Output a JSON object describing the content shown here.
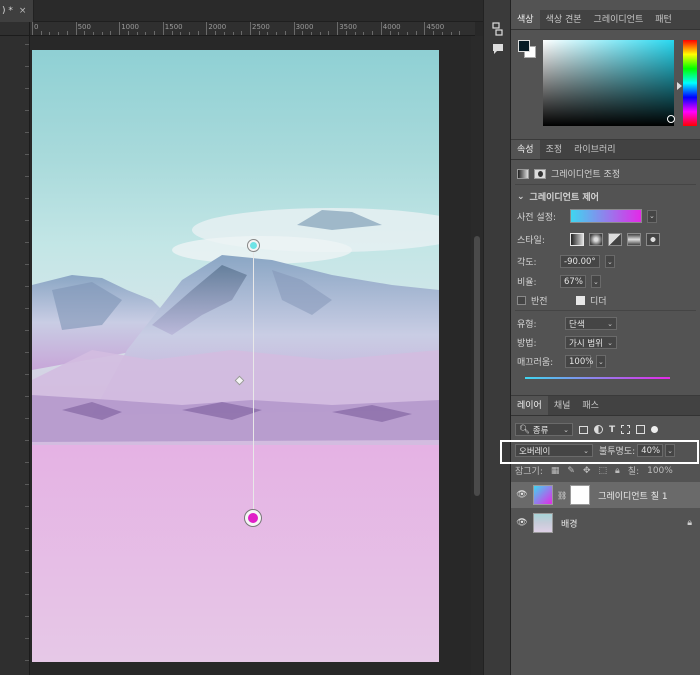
{
  "document": {
    "tab_title": ") *",
    "tab_close": "×",
    "ruler_labels": [
      "0",
      "500",
      "1000",
      "1500",
      "2000",
      "2500",
      "3000",
      "3500",
      "4000",
      "4500"
    ]
  },
  "tool_strip": {
    "icons": [
      "history-icon",
      "comment-icon"
    ]
  },
  "color_panel": {
    "tabs": [
      "색상",
      "색상 견본",
      "그레이디언트",
      "패턴"
    ],
    "foreground_color": "#061a24",
    "background_color": "#ffffff",
    "picker_hue": "#28d8f0"
  },
  "properties_panel": {
    "tabs": [
      "속성",
      "조정",
      "라이브러리"
    ],
    "adjustment_title": "그레이디언트 조정",
    "section_title": "그레이디언트 제어",
    "preset_label": "사전 설정:",
    "style_label": "스타일:",
    "angle_label": "각도:",
    "angle_value": "-90.00°",
    "scale_label": "비율:",
    "scale_value": "67%",
    "reverse_label": "반전",
    "reverse_checked": false,
    "dither_label": "디더",
    "dither_checked": true,
    "type_label": "유형:",
    "type_value": "단색",
    "method_label": "방법:",
    "method_value": "가시 범위",
    "smoothness_label": "매끄러움:",
    "smoothness_value": "100%",
    "gradient_colors": [
      "#3fd6f0",
      "#e429e8"
    ]
  },
  "layers_panel": {
    "tabs": [
      "레이어",
      "채널",
      "패스"
    ],
    "filter_value": "종류",
    "blend_mode": "오버레이",
    "opacity_label": "불투명도:",
    "opacity_value": "40%",
    "lock_label": "잠그기:",
    "fill_label": "칠:",
    "fill_value": "100%",
    "layers": [
      {
        "name": "그레이디언트 칠 1",
        "selected": true
      },
      {
        "name": "배경",
        "selected": false,
        "locked": true
      }
    ]
  }
}
